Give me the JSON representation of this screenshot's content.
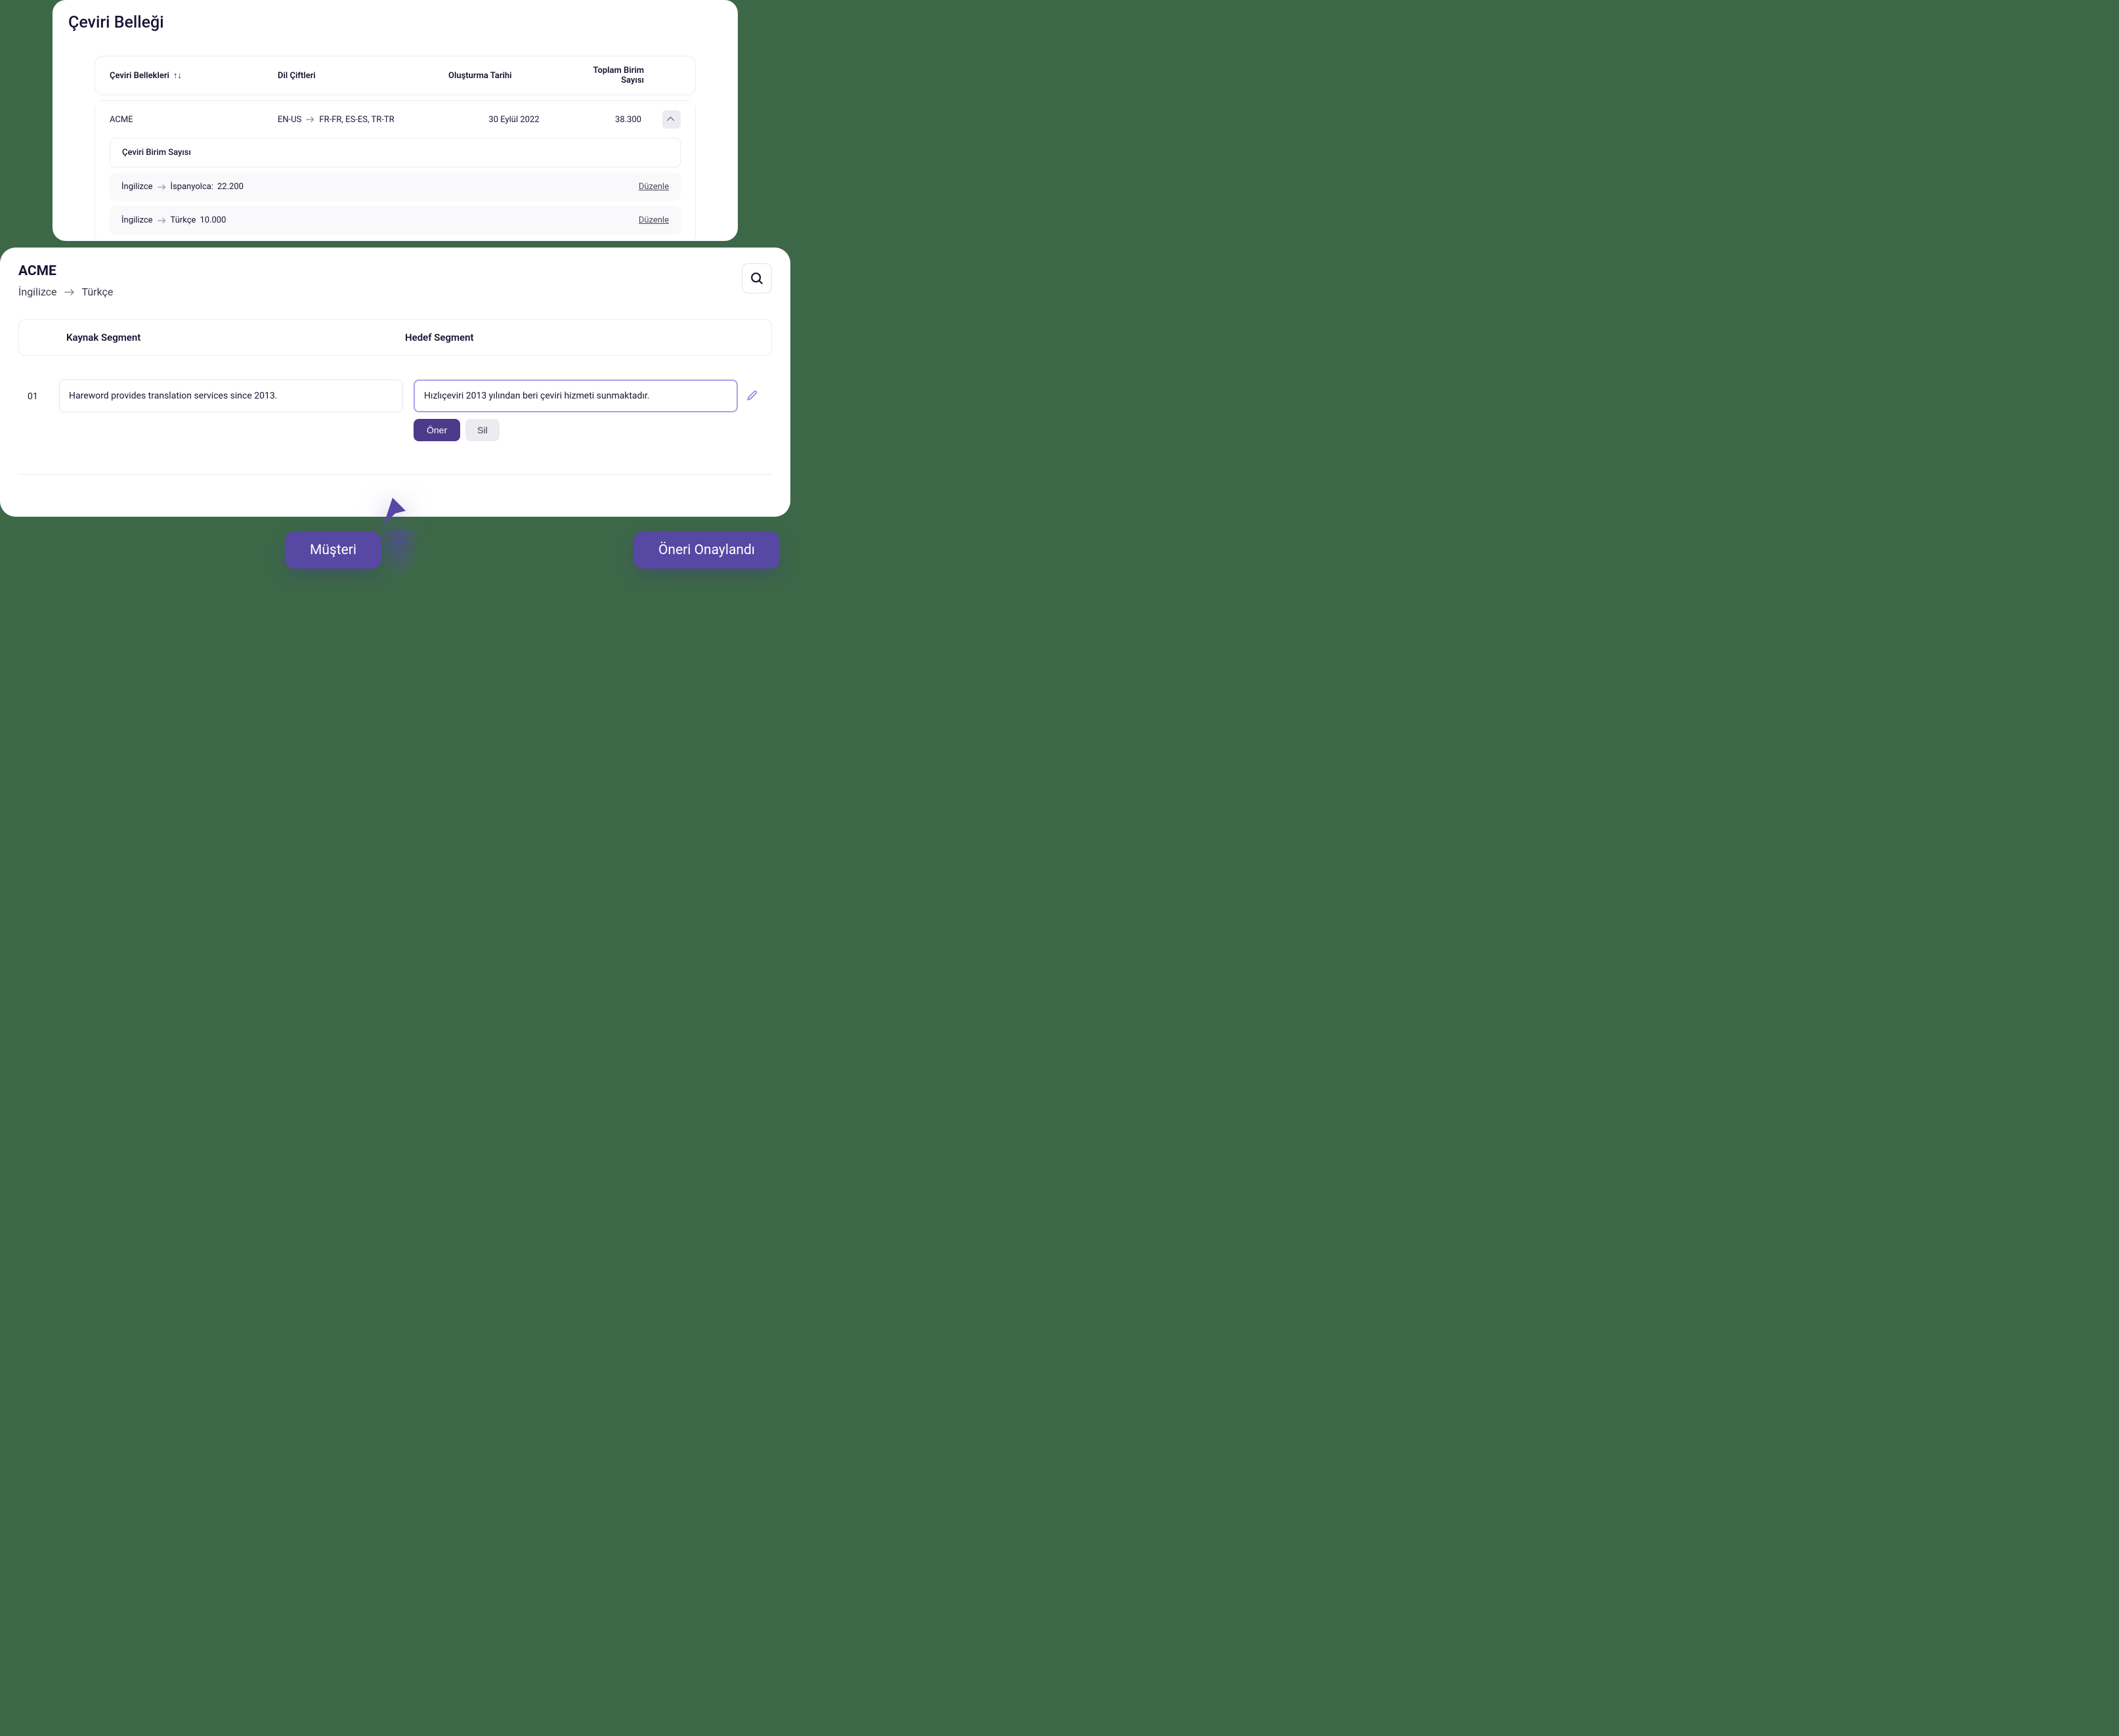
{
  "page": {
    "title": "Çeviri Belleği"
  },
  "tm": {
    "headers": {
      "name": "Çeviri Bellekleri",
      "pair": "Dil Çiftleri",
      "date": "Oluşturma Tarihi",
      "total": "Toplam Birim Sayısı"
    },
    "row": {
      "name": "ACME",
      "sourceLocale": "EN-US",
      "targetLocales": "FR-FR, ES-ES, TR-TR",
      "date": "30 Eylül 2022",
      "total": "38.300"
    },
    "unit_label": "Çeviri Birim Sayısı",
    "pairs": [
      {
        "src": "İngilizce",
        "tgt": "İspanyolca:",
        "count": "22.200",
        "edit": "Düzenle"
      },
      {
        "src": "İngilizce",
        "tgt": "Türkçe",
        "count": "10.000",
        "edit": "Düzenle"
      }
    ]
  },
  "detail": {
    "account": "ACME",
    "src_lang": "İngilizce",
    "tgt_lang": "Türkçe",
    "headers": {
      "src": "Kaynak Segment",
      "tgt": "Hedef Segment"
    },
    "segment": {
      "idx": "01",
      "src": "Hareword provides translation services since 2013.",
      "tgt": "Hızlıçeviri 2013 yılından beri çeviri hizmeti sunmaktadır.",
      "suggest": "Öner",
      "delete": "Sil"
    }
  },
  "pills": {
    "customer": "Müşteri",
    "approved": "Öneri Onaylandı"
  }
}
